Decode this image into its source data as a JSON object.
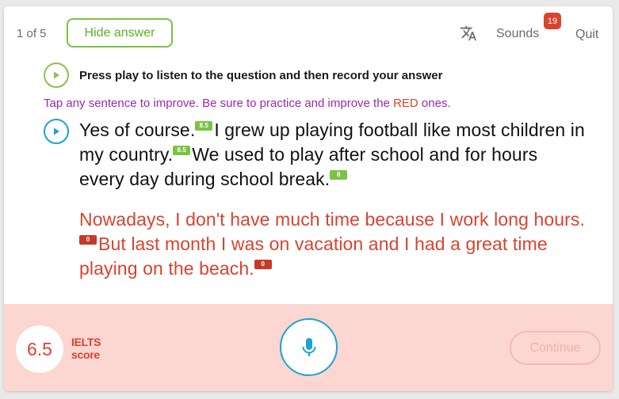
{
  "header": {
    "counter": "1 of 5",
    "hide_answer_label": "Hide answer",
    "translate_icon": "translate-icon",
    "sounds_label": "Sounds",
    "sounds_badge": "19",
    "quit_label": "Quit"
  },
  "question": {
    "play_icon": "play-icon",
    "instruction": "Press play to listen to the question and then record your answer",
    "hint_before": "Tap any sentence to improve. Be sure to practice and improve the ",
    "hint_red": "RED",
    "hint_after": " ones."
  },
  "answer": {
    "play_icon": "play-icon",
    "sentences": [
      {
        "text": "Yes of course.",
        "score": "8.5"
      },
      {
        "text": "I grew up playing football like most children in my country.",
        "score": "8.5"
      },
      {
        "text": "We used to play after school and for hours every day during school break.",
        "score": "8"
      },
      {
        "text": "Nowadays, I don't have much time because I work long hours.",
        "score": "0"
      },
      {
        "text": "But last month I was on vacation and I had a great time playing on the beach.",
        "score": "0"
      }
    ]
  },
  "footer": {
    "score_value": "6.5",
    "score_label_line1": "IELTS",
    "score_label_line2": "score",
    "mic_icon": "microphone-icon",
    "continue_label": "Continue"
  },
  "colors": {
    "accent_green": "#7cc243",
    "accent_blue": "#1aa3d6",
    "error_red": "#d9432f",
    "hint_purple": "#9c27b0",
    "footer_bg": "#fcd6d0"
  }
}
